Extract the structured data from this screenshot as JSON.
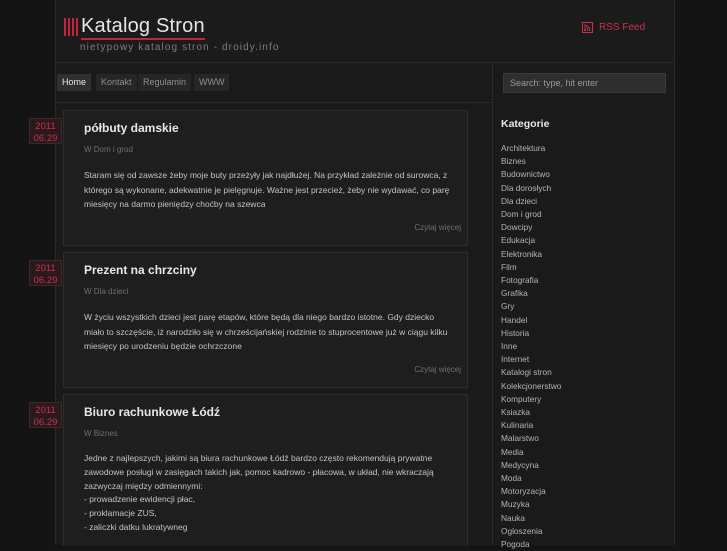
{
  "header": {
    "title": "Katalog Stron",
    "tagline": "nietypowy katalog stron - droidy.info",
    "rss_label": "RSS Feed"
  },
  "nav": {
    "items": [
      "Home",
      "Kontakt",
      "Regulamin",
      "WWW"
    ],
    "active": "Home"
  },
  "search": {
    "placeholder": "Search: type, hit enter"
  },
  "colors": {
    "accent": "#c2243f",
    "background": "#141414"
  },
  "posts": [
    {
      "year": "2011",
      "day": "06.29",
      "title": "półbuty damskie",
      "category": "W Dom i grod",
      "paragraphs": [
        "Staram się od zawsze żeby moje buty przeżyły jak najdłużej. Na przykład zależnie od surowca, z którego są wykonane, adekwatnie je pielęgnuje. Ważne jest przecież, żeby nie wydawać, co parę miesięcy na darmo pieniędzy choćby na szewca"
      ],
      "read_more": "Czytaj więcej"
    },
    {
      "year": "2011",
      "day": "06.29",
      "title": "Prezent na chrzciny",
      "category": "W Dla dzieci",
      "paragraphs": [
        "W życiu wszystkich dzieci jest parę etapów, które będą dla niego bardzo istotne. Gdy dziecko miało to szczęście, iż narodziło się w chrześcijańskiej rodzinie to stuprocentowe już w ciągu kilku miesięcy po urodzeniu będzie ochrzczone"
      ],
      "read_more": "Czytaj więcej"
    },
    {
      "year": "2011",
      "day": "06.29",
      "title": "Biuro rachunkowe Łódź",
      "category": "W Biznes",
      "paragraphs": [
        "Jedne z najlepszych, jakimi są biura rachunkowe Łódź bardzo często rekomendują prywatne zawodowe posługi w zasięgach takich jak, pomoc kadrowo - płacowa, w układ, nie wkraczają zazwyczaj między odmiennymi:",
        "- prowadzenie ewidencji płac,",
        "- proklamacje ZUS,",
        "- zaliczki datku lukratywneg"
      ],
      "read_more": ""
    }
  ],
  "sidebar": {
    "title": "Kategorie",
    "categories": [
      "Architektura",
      "Biznes",
      "Budownictwo",
      "Dla dorosłych",
      "Dla dzieci",
      "Dom i grod",
      "Dowcipy",
      "Edukacja",
      "Elektronika",
      "Film",
      "Fotografia",
      "Grafika",
      "Gry",
      "Handel",
      "Historia",
      "Inne",
      "Internet",
      "Katalogi stron",
      "Kolekcjonerstwo",
      "Komputery",
      "Ksiazka",
      "Kulinaria",
      "Malarstwo",
      "Media",
      "Medycyna",
      "Moda",
      "Motoryzacja",
      "Muzyka",
      "Nauka",
      "Ogloszenia",
      "Pogoda"
    ]
  }
}
